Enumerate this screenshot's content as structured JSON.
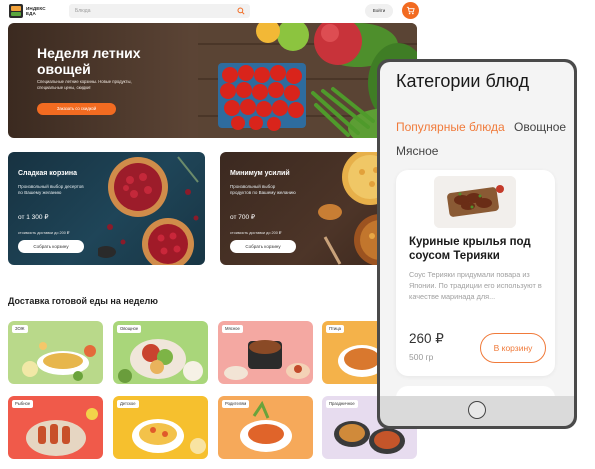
{
  "header": {
    "logo_text": "ИНДЕКС ЕДА",
    "search_placeholder": "Блюда",
    "login_label": "Войти",
    "icons": {
      "search": "search-icon",
      "cart": "cart-icon"
    }
  },
  "hero": {
    "title": "Неделя летних овощей",
    "subtitle": "Специальные летние корзины. Новые продукты, специальные цены, скидки!",
    "button_label": "Заказать со скидкой"
  },
  "promos": [
    {
      "title": "Сладкая корзина",
      "description": "Произвольный выбор десертов по Вашему желанию",
      "price": "от 1 300 ₽",
      "delivery": "стоимость доставки до 200 ₽",
      "button_label": "Собрать корзину"
    },
    {
      "title": "Минимум усилий",
      "description": "Произвольный выбор продуктов по Вашему желанию",
      "price": "от 700 ₽",
      "delivery": "стоимость доставки до 200 ₽",
      "button_label": "Собрать корзину"
    }
  ],
  "weekly": {
    "title": "Доставка готовой еды на неделю",
    "categories": [
      {
        "tag": "ЗОЖ"
      },
      {
        "tag": "Овощное"
      },
      {
        "tag": "Мясное"
      },
      {
        "tag": "Птица"
      },
      {
        "tag": "Рыбное"
      },
      {
        "tag": "Детское"
      },
      {
        "tag": "Родителям"
      },
      {
        "tag": "Праздничное"
      }
    ]
  },
  "phone": {
    "title": "Категории блюд",
    "tabs": [
      "Популярные блюда",
      "Овощное",
      "Мясное"
    ],
    "dish": {
      "name": "Куриные крылья под соусом Терияки",
      "description": "Соус Терияки придумали повара из Японии. По традиции его используют в качестве маринада для...",
      "price": "260 ₽",
      "weight": "500 гр",
      "button_label": "В корзину"
    }
  },
  "colors": {
    "accent": "#f26b21",
    "tab_active": "#f07a3a"
  }
}
